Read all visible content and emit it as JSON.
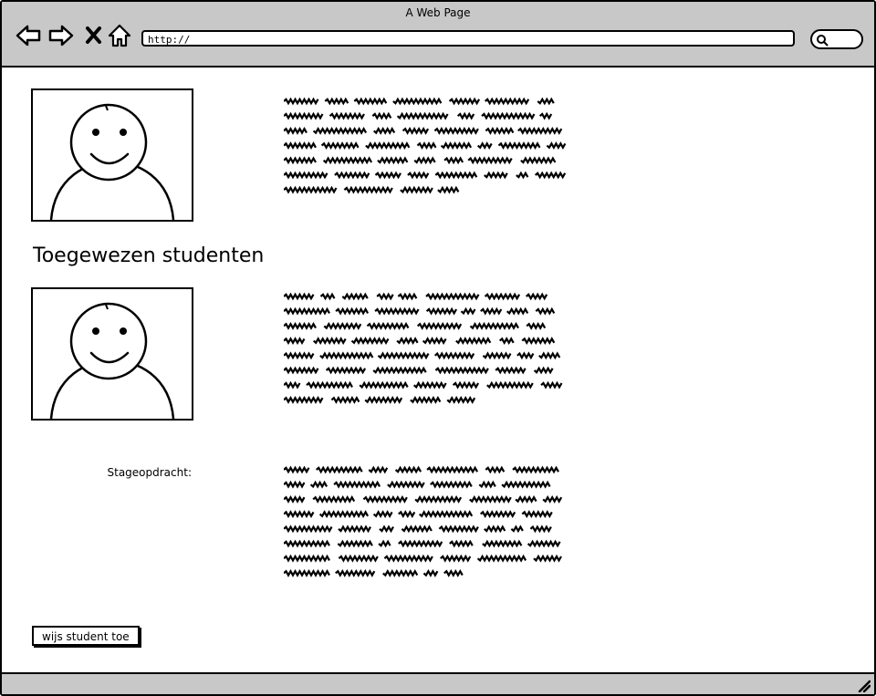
{
  "browser": {
    "title": "A Web Page",
    "url": "http://",
    "nav_icons": [
      "back-arrow-icon",
      "forward-arrow-icon",
      "stop-x-icon",
      "home-icon"
    ],
    "search_icon": "magnifier-icon"
  },
  "content": {
    "heading": "Toegewezen studenten",
    "assignment_label": "Stageopdracht:",
    "assign_button": "wijs student toe",
    "text_blocks": [
      {
        "lines": 7
      },
      {
        "lines": 8
      },
      {
        "lines": 8
      }
    ]
  }
}
